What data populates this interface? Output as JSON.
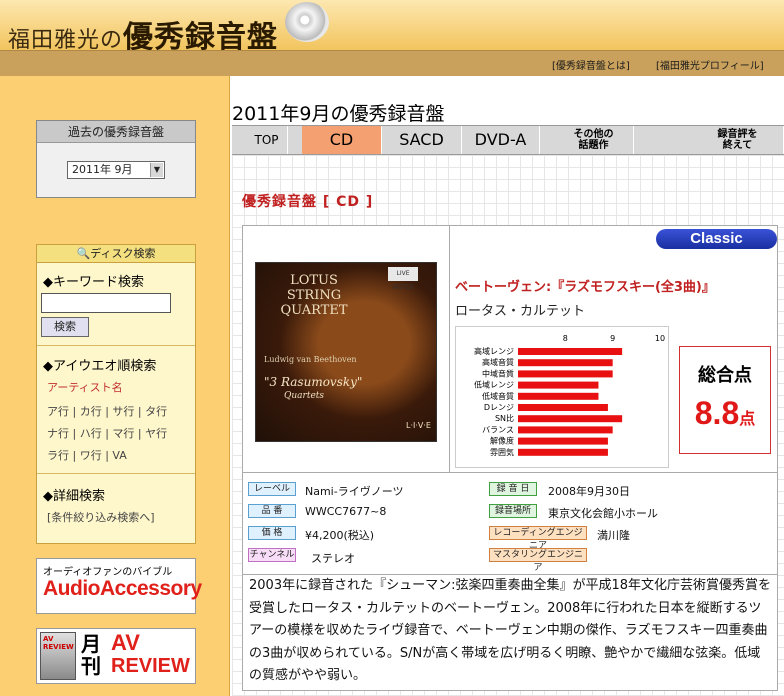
{
  "site": {
    "title_small": "福田雅光の",
    "title_big": "優秀録音盤"
  },
  "header_links": {
    "about": "[優秀録音盤とは]",
    "profile": "[福田雅光プロフィール]"
  },
  "sidebar": {
    "past_title": "過去の優秀録音盤",
    "month_select": "2011年 9月",
    "disc_search_title": "ディスク検索",
    "keyword_heading": "◆キーワード検索",
    "search_button": "検索",
    "aiueo_heading": "◆アイウエオ順検索",
    "artist_label": "アーティスト名",
    "kana_rows": [
      "ア行 | カ行 | サ行 | タ行",
      "ナ行 | ハ行 | マ行 | ヤ行",
      "ラ行 | ワ行 | VA"
    ],
    "detail_heading": "◆詳細検索",
    "detail_link": "[条件絞り込み検索へ]",
    "banner_aa_tagline": "オーディオファンのバイブル",
    "banner_aa_name": "AudioAccessory",
    "banner_av_gekkan": "月刊",
    "banner_av_name1": "AV",
    "banner_av_name2": "REVIEW",
    "banner_av_cover": "AV REVIEW"
  },
  "page_title": "2011年9月の優秀録音盤",
  "tabs": [
    {
      "label": "TOP"
    },
    {
      "label": "CD",
      "active": true
    },
    {
      "label": "SACD"
    },
    {
      "label": "DVD-A"
    },
    {
      "label": "その他の\n話題作"
    },
    {
      "label": "録音評を\n終えて"
    }
  ],
  "section_title": "優秀録音盤 [ CD ]",
  "genre_badge": "Classic",
  "album": {
    "title": "ベートーヴェン:『ラズモフスキー(全3曲)』",
    "artist": "ロータス・カルテット",
    "cover": {
      "line1": "LOTUS",
      "line2": "STRING",
      "line3": "QUARTET",
      "label_badge": "LIVE NOTES",
      "composer": "Ludwig van Beethoven",
      "work": "\"3 Rasumovsky\"",
      "work2": "Quartets",
      "live": "L·I·V·E"
    }
  },
  "overall": {
    "label": "総合点",
    "score": "8.8",
    "unit": "点"
  },
  "meta": {
    "label_tag": "レーベル",
    "label_val": "Nami-ライヴノーツ",
    "number_tag": "品 番",
    "number_val": "WWCC7677~8",
    "price_tag": "価 格",
    "price_val": "¥4,200(税込)",
    "channel_tag": "チャンネル",
    "channel_val": "ステレオ",
    "date_tag": "録 音 日",
    "date_val": "2008年9月30日",
    "place_tag": "録音場所",
    "place_val": "東京文化会館小ホール",
    "rec_eng_tag": "レコーディングエンジニア",
    "rec_eng_val": "満川隆",
    "mas_eng_tag": "マスタリングエンジニア"
  },
  "description": "2003年に録音された『シューマン:弦楽四重奏曲全集』が平成18年文化庁芸術賞優秀賞を受賞したロータス・カルテットのベートーヴェン。2008年に行われた日本を縦断するツアーの模様を収めたライヴ録音で、ベートーヴェン中期の傑作、ラズモフスキー四重奏曲の3曲が収められている。S/Nが高く帯域を広げ明るく明瞭、艶やかで繊細な弦楽。低域の質感がやや弱い。",
  "chart_data": {
    "type": "bar",
    "orientation": "horizontal",
    "categories": [
      "高域レンジ",
      "高域音質",
      "中域音質",
      "低域レンジ",
      "低域音質",
      "Dレンジ",
      "SN比",
      "バランス",
      "解像度",
      "雰囲気"
    ],
    "values": [
      9.2,
      9.0,
      9.0,
      8.7,
      8.7,
      8.9,
      9.2,
      9.0,
      8.9,
      8.9
    ],
    "xticks": [
      8,
      9,
      10
    ],
    "xlim": [
      7.0,
      10.0
    ],
    "bar_color": "#e81010",
    "title": "",
    "xlabel": "",
    "ylabel": ""
  }
}
